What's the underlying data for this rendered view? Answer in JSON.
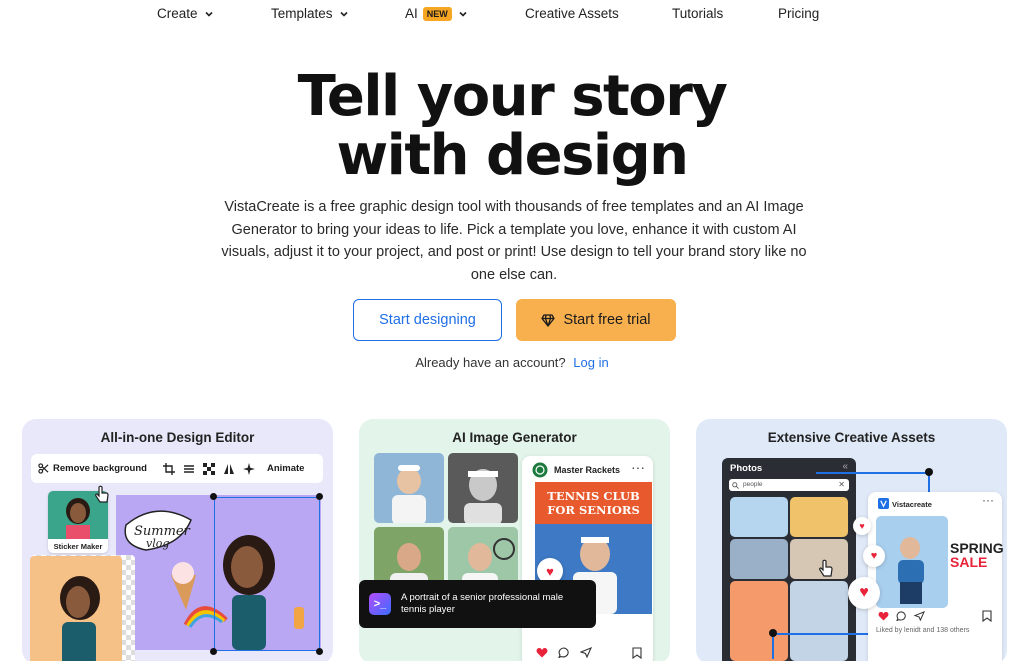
{
  "nav": {
    "items": [
      {
        "label": "Create",
        "has_chevron": true
      },
      {
        "label": "Templates",
        "has_chevron": true
      },
      {
        "label": "AI",
        "badge": "NEW",
        "has_chevron": true
      },
      {
        "label": "Creative Assets",
        "has_chevron": false
      },
      {
        "label": "Tutorials",
        "has_chevron": false
      },
      {
        "label": "Pricing",
        "has_chevron": false
      }
    ]
  },
  "hero": {
    "title_line1": "Tell your story",
    "title_line2": "with design",
    "description": "VistaCreate is a free graphic design tool with thousands of free templates and an AI Image Generator to bring your ideas to life. Pick a template you love, enhance it with custom AI visuals, adjust it to your project, and post or print! Use design to tell your brand story like no one else can.",
    "primary_button": "Start designing",
    "trial_button": "Start free trial",
    "login_prompt": "Already have an account?",
    "login_link": "Log in"
  },
  "cards": [
    {
      "title": "All-in-one Design Editor",
      "toolbar": {
        "remove_bg": "Remove background",
        "animate": "Animate"
      },
      "sticker_label": "Sticker Maker"
    },
    {
      "title": "AI Image Generator",
      "post_account": "Master Rackets",
      "poster_title": "TENNIS CLUB FOR SENIORS",
      "prompt_text": "A portrait of a senior professional male tennis player"
    },
    {
      "title": "Extensive Creative Assets",
      "photos_label": "Photos",
      "search_value": "people",
      "post_brand": "Vistacreate",
      "spring": "SPRING",
      "sale": "SALE",
      "likes_text": "Liked by lenidt and 138 others"
    }
  ],
  "colors": {
    "accent_blue": "#1f6fe5",
    "trial_orange": "#f8b04e",
    "new_badge": "#f6a623",
    "card1_bg": "#e9e8fb",
    "card2_bg": "#e3f4ea",
    "card3_bg": "#dfe9f8"
  }
}
